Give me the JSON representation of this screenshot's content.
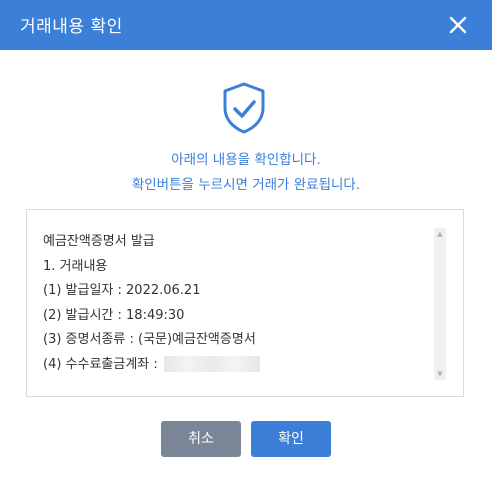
{
  "dialog": {
    "title": "거래내용 확인",
    "close_icon": "close-icon"
  },
  "confirm_icon": "shield-check-icon",
  "message": {
    "line1": "아래의 내용을 확인합니다.",
    "line2": "확인버튼을 누르시면 거래가 완료됩니다."
  },
  "details": {
    "lines": [
      "예금잔액증명서 발급",
      "1. 거래내용",
      "(1) 발급일자 : 2022.06.21",
      "(2) 발급시간 : 18:49:30",
      "(3) 증명서종류 : (국문)예금잔액증명서",
      "(4) 수수료출금계좌 :"
    ]
  },
  "buttons": {
    "cancel": "취소",
    "confirm": "확인"
  },
  "colors": {
    "accent": "#3b7fd9",
    "cancel": "#7a8595"
  }
}
